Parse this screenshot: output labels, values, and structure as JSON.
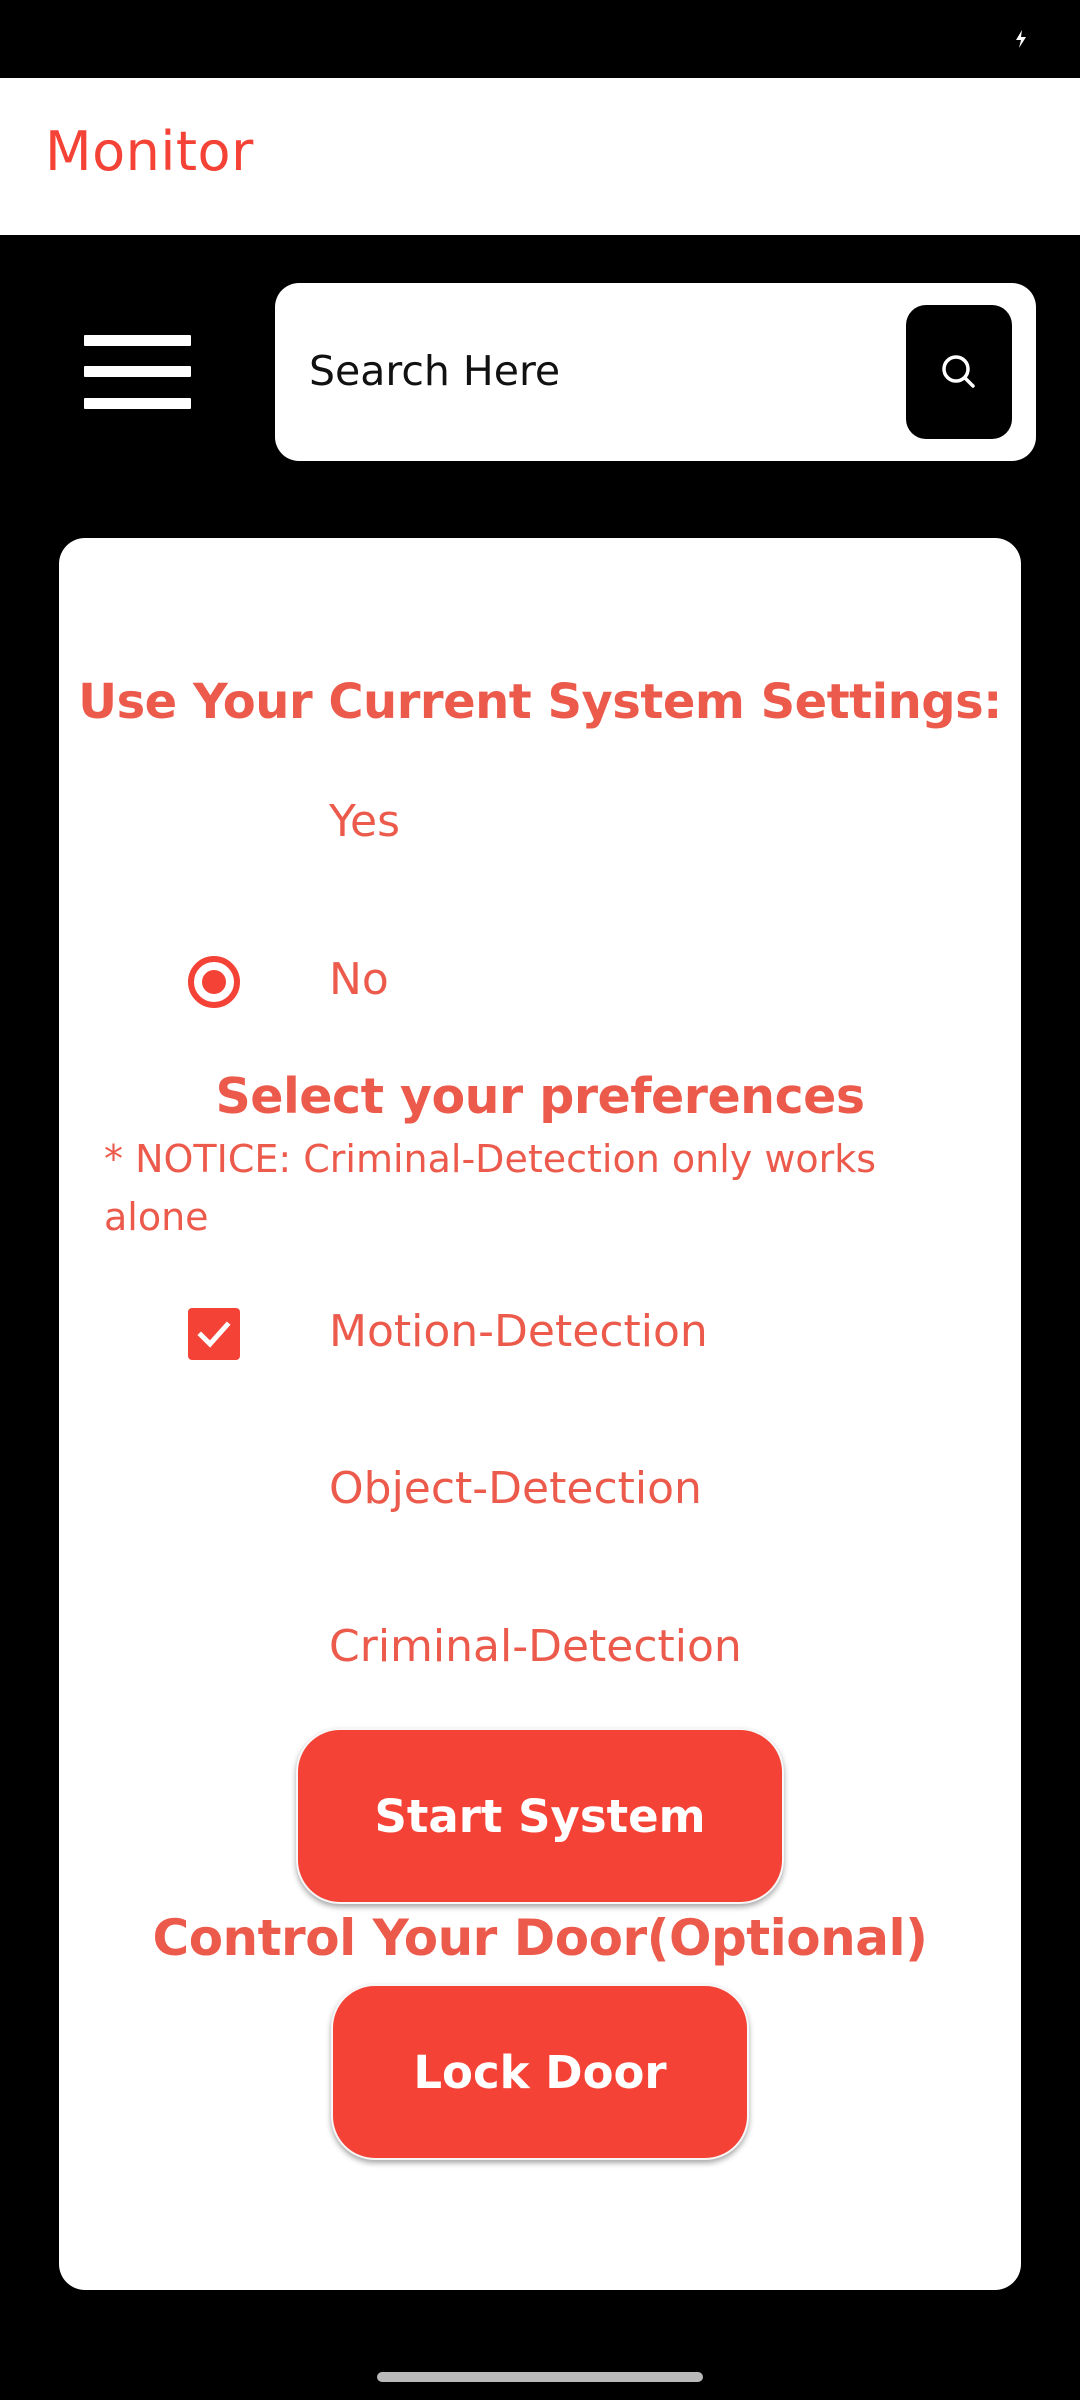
{
  "app_bar": {
    "title": "Monitor"
  },
  "search": {
    "placeholder": "Search Here"
  },
  "settings": {
    "heading": "Use Your Current System Settings:",
    "options": [
      {
        "label": "Yes",
        "selected": false
      },
      {
        "label": "No",
        "selected": true
      }
    ]
  },
  "preferences": {
    "heading": "Select your preferences",
    "notice": "* NOTICE: Criminal-Detection only works alone",
    "options": [
      {
        "label": "Motion-Detection",
        "checked": true
      },
      {
        "label": "Object-Detection",
        "checked": false
      },
      {
        "label": "Criminal-Detection",
        "checked": false
      }
    ]
  },
  "buttons": {
    "start": "Start System",
    "lock": "Lock Door"
  },
  "door": {
    "heading": "Control Your Door(Optional)"
  },
  "colors": {
    "accent": "#f44336",
    "text_accent": "#ec5a4c",
    "background": "#000000",
    "surface": "#ffffff"
  },
  "icons": {
    "menu": "hamburger-menu-icon",
    "search": "search-icon",
    "status": "battery-charging-icon",
    "check": "check-icon"
  }
}
